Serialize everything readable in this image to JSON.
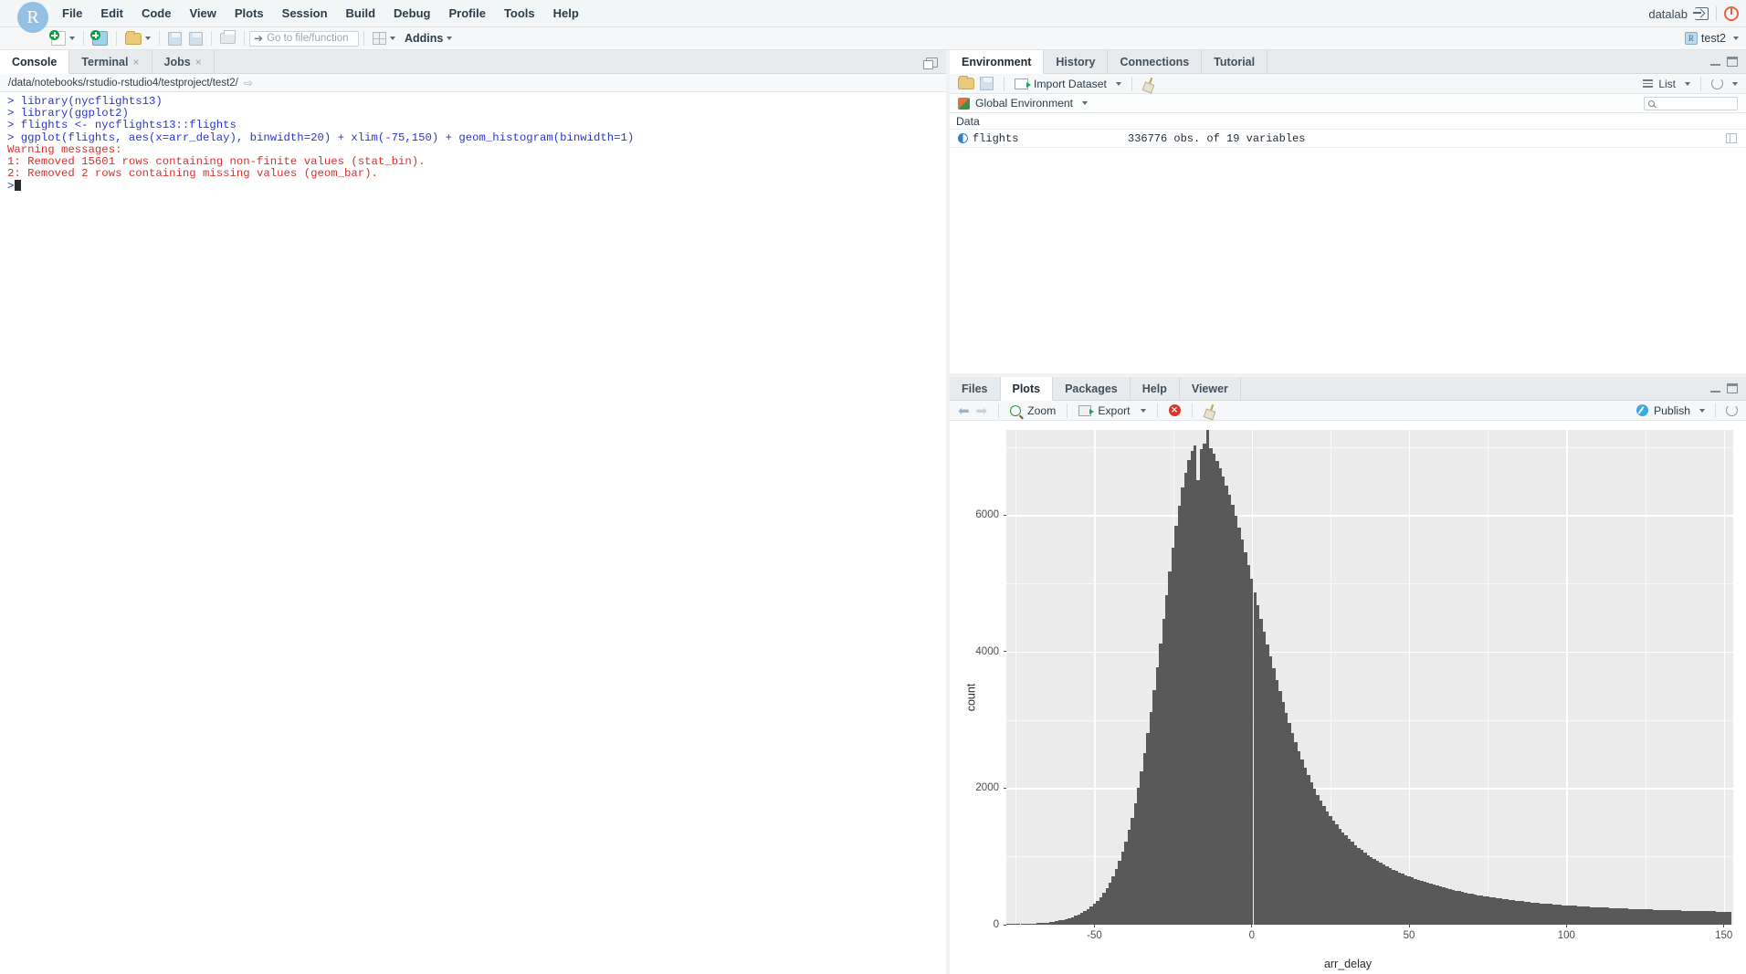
{
  "app": {
    "title": "RStudio",
    "logo_letter": "R"
  },
  "menubar": {
    "items": [
      {
        "label": "File"
      },
      {
        "label": "Edit"
      },
      {
        "label": "Code"
      },
      {
        "label": "View"
      },
      {
        "label": "Plots"
      },
      {
        "label": "Session"
      },
      {
        "label": "Build"
      },
      {
        "label": "Debug"
      },
      {
        "label": "Profile"
      },
      {
        "label": "Tools"
      },
      {
        "label": "Help"
      }
    ],
    "user": "datalab",
    "signout_icon": "sign-out-icon",
    "power_icon": "power-icon"
  },
  "toolbar": {
    "new_file_icon": "new-file-icon",
    "new_project_icon": "new-project-icon",
    "open_file_icon": "open-folder-icon",
    "save_icon": "save-icon",
    "save_all_icon": "save-all-icon",
    "print_icon": "print-icon",
    "goto_placeholder": "Go to file/function",
    "panes_icon": "workspace-panes-icon",
    "addins_label": "Addins",
    "project_name": "test2"
  },
  "console": {
    "tabs": [
      {
        "label": "Console",
        "active": true,
        "closable": false
      },
      {
        "label": "Terminal",
        "active": false,
        "closable": true
      },
      {
        "label": "Jobs",
        "active": false,
        "closable": true
      }
    ],
    "path": "/data/notebooks/rstudio-rstudio4/testproject/test2/",
    "lines": [
      {
        "type": "input",
        "text": "> library(nycflights13)"
      },
      {
        "type": "input",
        "text": "> library(ggplot2)"
      },
      {
        "type": "input",
        "text": "> flights <- nycflights13::flights"
      },
      {
        "type": "input",
        "text": "> ggplot(flights, aes(x=arr_delay), binwidth=20) + xlim(-75,150) + geom_histogram(binwidth=1)"
      },
      {
        "type": "error",
        "text": "Warning messages:"
      },
      {
        "type": "error",
        "text": "1: Removed 15601 rows containing non-finite values (stat_bin)."
      },
      {
        "type": "error",
        "text": "2: Removed 2 rows containing missing values (geom_bar)."
      }
    ],
    "prompt": ">"
  },
  "environment": {
    "tabs": [
      {
        "label": "Environment",
        "active": true
      },
      {
        "label": "History",
        "active": false
      },
      {
        "label": "Connections",
        "active": false
      },
      {
        "label": "Tutorial",
        "active": false
      }
    ],
    "toolbar": {
      "load_icon": "load-workspace-icon",
      "save_icon": "save-workspace-icon",
      "import_label": "Import Dataset",
      "clear_icon": "broom-clear-icon",
      "view_mode": "List",
      "refresh_icon": "refresh-icon"
    },
    "scope": "Global Environment",
    "search_placeholder": "",
    "section_label": "Data",
    "rows": [
      {
        "name": "flights",
        "value": "336776 obs. of  19 variables"
      }
    ]
  },
  "plots": {
    "tabs": [
      {
        "label": "Files",
        "active": false
      },
      {
        "label": "Plots",
        "active": true
      },
      {
        "label": "Packages",
        "active": false
      },
      {
        "label": "Help",
        "active": false
      },
      {
        "label": "Viewer",
        "active": false
      }
    ],
    "toolbar": {
      "back_icon": "arrow-left-icon",
      "forward_icon": "arrow-right-icon",
      "zoom_label": "Zoom",
      "export_label": "Export",
      "remove_icon": "remove-plot-icon",
      "clear_icon": "broom-clear-icon",
      "publish_label": "Publish",
      "refresh_icon": "refresh-icon"
    }
  },
  "chart_data": {
    "type": "bar",
    "title": "",
    "xlabel": "arr_delay",
    "ylabel": "count",
    "xlim": [
      -78,
      153
    ],
    "ylim": [
      0,
      7250
    ],
    "xticks": [
      -50,
      0,
      50,
      100,
      150
    ],
    "yticks": [
      0,
      2000,
      4000,
      6000
    ],
    "grid": true,
    "legend": "none",
    "binwidth": 1,
    "bar_color": "#595959",
    "panel_bg": "#EBEBEB",
    "gridline_color": "#FFFFFF",
    "x": [
      -78,
      -77,
      -76,
      -75,
      -74,
      -73,
      -72,
      -71,
      -70,
      -69,
      -68,
      -67,
      -66,
      -65,
      -64,
      -63,
      -62,
      -61,
      -60,
      -59,
      -58,
      -57,
      -56,
      -55,
      -54,
      -53,
      -52,
      -51,
      -50,
      -49,
      -48,
      -47,
      -46,
      -45,
      -44,
      -43,
      -42,
      -41,
      -40,
      -39,
      -38,
      -37,
      -36,
      -35,
      -34,
      -33,
      -32,
      -31,
      -30,
      -29,
      -28,
      -27,
      -26,
      -25,
      -24,
      -23,
      -22,
      -21,
      -20,
      -19,
      -18,
      -17,
      -16,
      -15,
      -14,
      -13,
      -12,
      -11,
      -10,
      -9,
      -8,
      -7,
      -6,
      -5,
      -4,
      -3,
      -2,
      -1,
      0,
      1,
      2,
      3,
      4,
      5,
      6,
      7,
      8,
      9,
      10,
      11,
      12,
      13,
      14,
      15,
      16,
      17,
      18,
      19,
      20,
      21,
      22,
      23,
      24,
      25,
      26,
      27,
      28,
      29,
      30,
      31,
      32,
      33,
      34,
      35,
      36,
      37,
      38,
      39,
      40,
      41,
      42,
      43,
      44,
      45,
      46,
      47,
      48,
      49,
      50,
      51,
      52,
      53,
      54,
      55,
      56,
      57,
      58,
      59,
      60,
      61,
      62,
      63,
      64,
      65,
      66,
      67,
      68,
      69,
      70,
      71,
      72,
      73,
      74,
      75,
      76,
      77,
      78,
      79,
      80,
      81,
      82,
      83,
      84,
      85,
      86,
      87,
      88,
      89,
      90,
      91,
      92,
      93,
      94,
      95,
      96,
      97,
      98,
      99,
      100,
      101,
      102,
      103,
      104,
      105,
      106,
      107,
      108,
      109,
      110,
      111,
      112,
      113,
      114,
      115,
      116,
      117,
      118,
      119,
      120,
      121,
      122,
      123,
      124,
      125,
      126,
      127,
      128,
      129,
      130,
      131,
      132,
      133,
      134,
      135,
      136,
      137,
      138,
      139,
      140,
      141,
      142,
      143,
      144,
      145,
      146,
      147,
      148,
      149,
      150,
      151,
      152
    ],
    "values": [
      4,
      5,
      6,
      7,
      8,
      9,
      11,
      13,
      15,
      18,
      21,
      24,
      28,
      33,
      38,
      45,
      52,
      61,
      70,
      82,
      95,
      110,
      128,
      148,
      172,
      199,
      230,
      266,
      307,
      354,
      408,
      470,
      541,
      622,
      714,
      818,
      936,
      1069,
      1218,
      1385,
      1571,
      1777,
      2003,
      2250,
      2518,
      2806,
      3113,
      3437,
      3775,
      4123,
      4477,
      4832,
      5182,
      5521,
      5842,
      6138,
      6402,
      6627,
      6809,
      6943,
      7025,
      6520,
      6975,
      7050,
      7250,
      6980,
      6900,
      6800,
      6690,
      6570,
      6440,
      6300,
      6150,
      5990,
      5820,
      5640,
      5455,
      5265,
      5070,
      4875,
      4680,
      4485,
      4295,
      4110,
      3930,
      3755,
      3585,
      3420,
      3260,
      3105,
      2955,
      2812,
      2675,
      2545,
      2422,
      2305,
      2195,
      2092,
      1995,
      1905,
      1820,
      1740,
      1665,
      1595,
      1530,
      1468,
      1410,
      1356,
      1305,
      1257,
      1212,
      1170,
      1130,
      1092,
      1056,
      1022,
      990,
      960,
      931,
      904,
      878,
      853,
      830,
      807,
      786,
      765,
      745,
      726,
      708,
      690,
      673,
      657,
      641,
      626,
      611,
      597,
      583,
      570,
      557,
      545,
      533,
      521,
      510,
      499,
      489,
      479,
      469,
      460,
      451,
      442,
      434,
      426,
      418,
      410,
      403,
      396,
      389,
      382,
      376,
      370,
      364,
      358,
      352,
      347,
      342,
      337,
      332,
      327,
      322,
      318,
      314,
      310,
      306,
      302,
      298,
      294,
      291,
      287,
      284,
      281,
      278,
      275,
      272,
      269,
      266,
      263,
      260,
      258,
      255,
      253,
      250,
      248,
      246,
      244,
      242,
      240,
      238,
      236,
      234,
      232,
      230,
      228,
      226,
      224,
      223,
      221,
      219,
      218,
      216,
      215,
      213,
      212,
      210,
      209,
      208,
      206,
      205,
      204,
      202,
      201,
      200,
      199,
      198,
      197,
      196,
      195,
      194,
      193,
      192,
      191,
      190,
      189,
      188,
      187,
      186,
      185,
      184,
      183
    ]
  }
}
